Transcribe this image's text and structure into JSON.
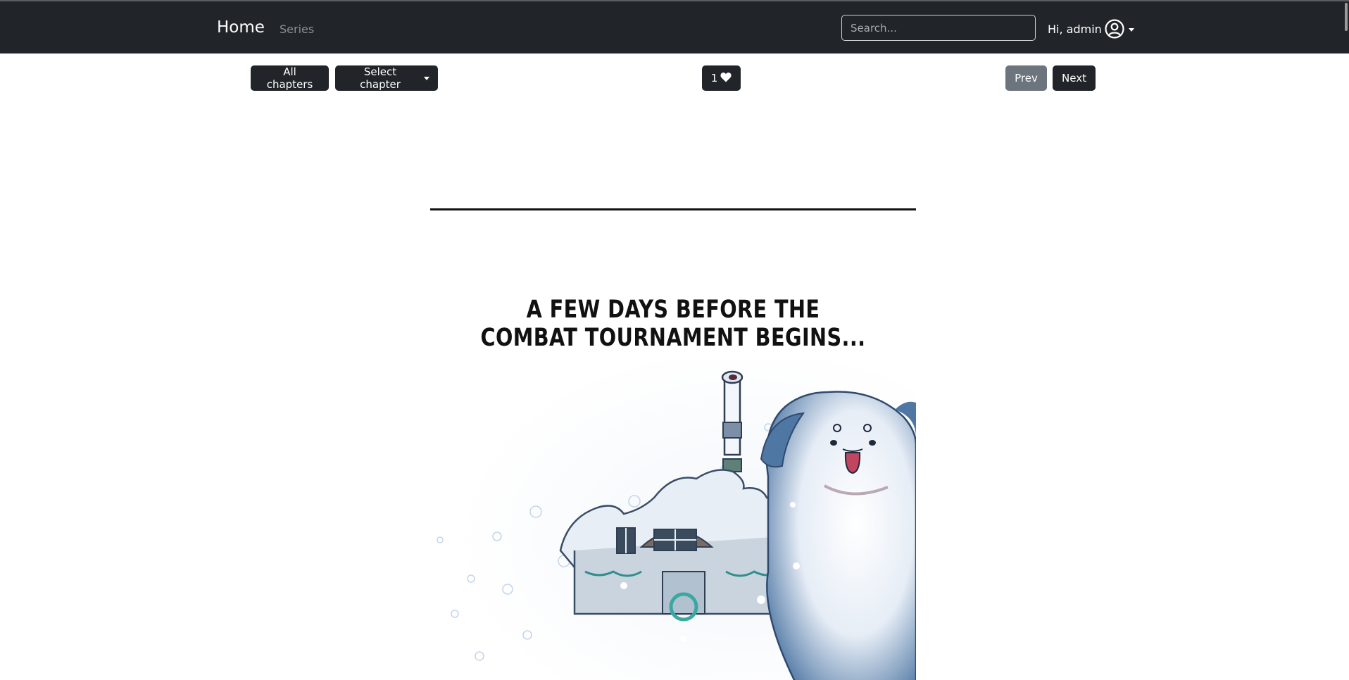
{
  "navbar": {
    "brand": "Home",
    "links": [
      {
        "label": "Series"
      }
    ],
    "search": {
      "placeholder": "Search...",
      "value": ""
    },
    "user": {
      "greeting": "Hi, admin",
      "icon": "user-circle-icon"
    }
  },
  "toolbar": {
    "all_chapters_label": "All chapters",
    "select_chapter_label": "Select chapter",
    "likes": {
      "count": "1",
      "icon": "heart-icon"
    },
    "prev_label": "Prev",
    "next_label": "Next"
  },
  "page": {
    "caption_lines": [
      "A FEW DAYS BEFORE THE",
      "COMBAT TOURNAMENT BEGINS..."
    ]
  },
  "colors": {
    "navbar_bg": "#212529",
    "button_bg": "#212529",
    "disabled_button_bg": "#6c757d",
    "page_bg": "#ffffff"
  }
}
